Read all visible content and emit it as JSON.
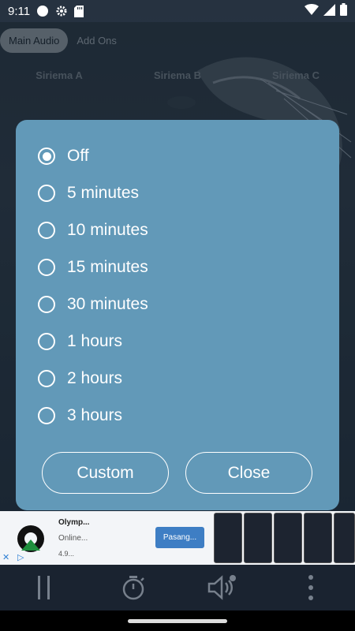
{
  "status_bar": {
    "time": "9:11",
    "icons": [
      "circle-icon",
      "gear-icon",
      "sd-card-icon",
      "wifi-icon",
      "signal-icon",
      "battery-icon"
    ]
  },
  "tabs": [
    {
      "label": "Main Audio",
      "active": true
    },
    {
      "label": "Add Ons",
      "active": false
    }
  ],
  "presets": [
    "Siriema A",
    "Siriema B",
    "Siriema C"
  ],
  "dialog": {
    "options": [
      {
        "label": "Off",
        "selected": true
      },
      {
        "label": "5 minutes",
        "selected": false
      },
      {
        "label": "10 minutes",
        "selected": false
      },
      {
        "label": "15 minutes",
        "selected": false
      },
      {
        "label": "30 minutes",
        "selected": false
      },
      {
        "label": "1 hours",
        "selected": false
      },
      {
        "label": "2 hours",
        "selected": false
      },
      {
        "label": "3 hours",
        "selected": false
      }
    ],
    "custom_label": "Custom",
    "close_label": "Close"
  },
  "ad": {
    "title": "Olymp...",
    "subtitle": "Online...",
    "rating": "4.9...",
    "cta": "Pasang..."
  },
  "bottom_bar": {
    "icons": [
      "pause-icon",
      "timer-icon",
      "volume-icon",
      "more-vert-icon"
    ]
  },
  "colors": {
    "dialog_bg": "#6299b8",
    "accent_button": "#3e7ec4"
  }
}
